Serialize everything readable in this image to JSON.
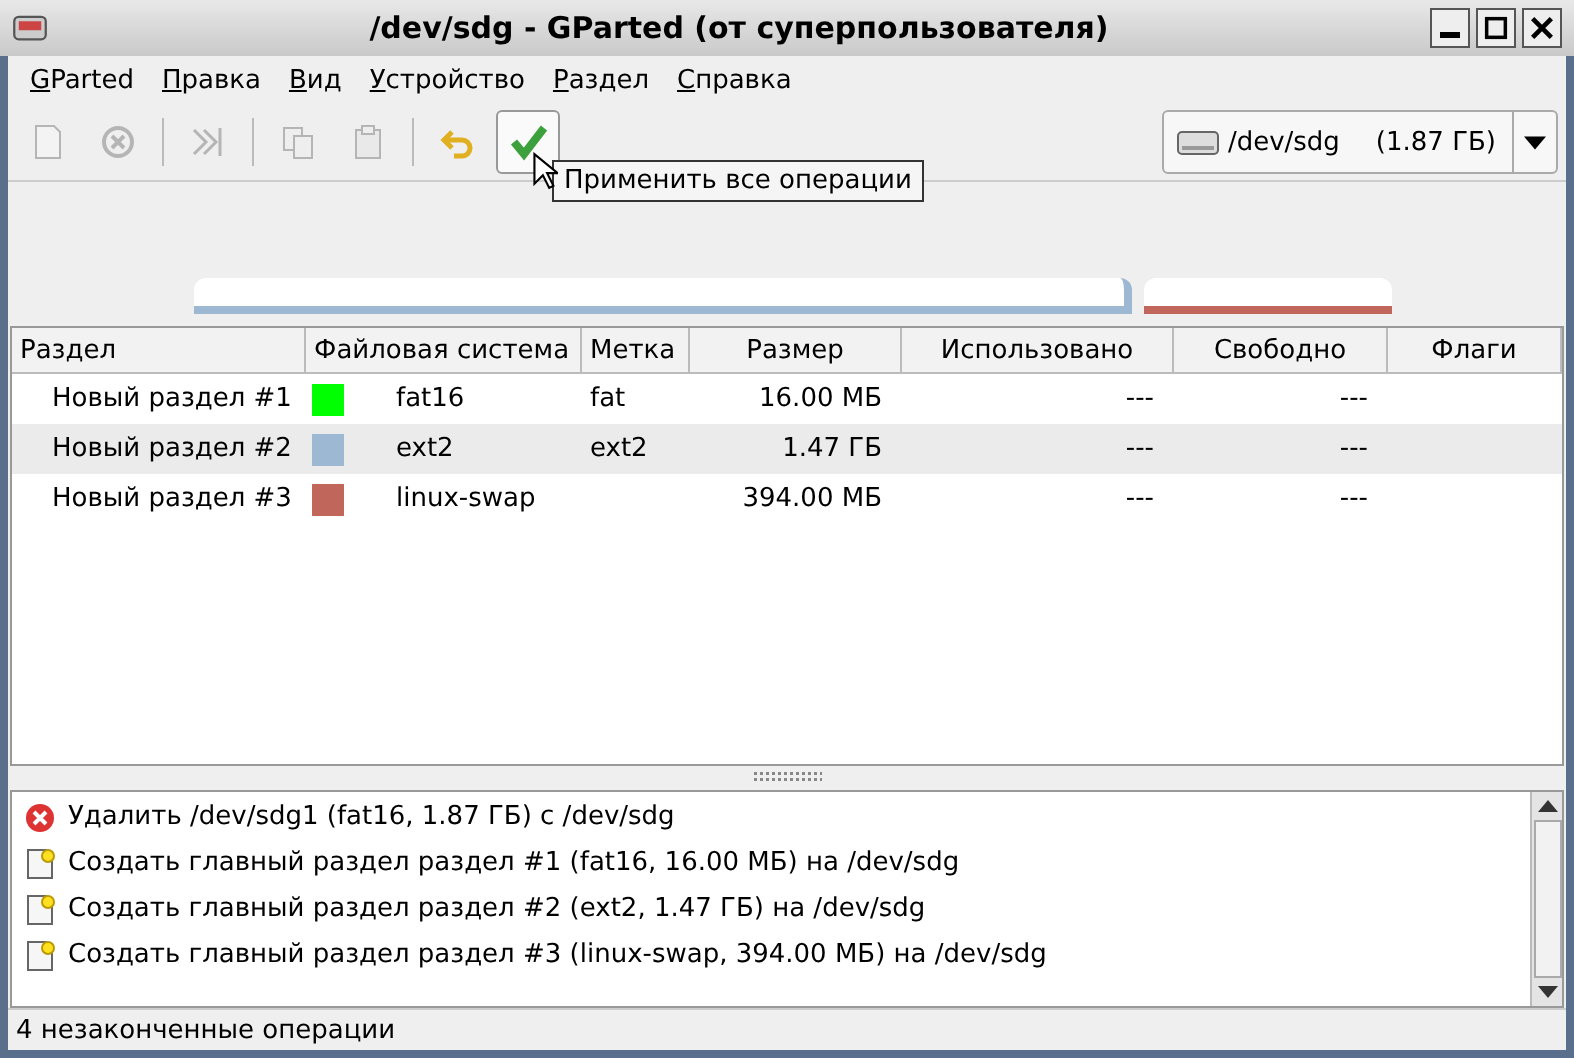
{
  "window": {
    "title": "/dev/sdg - GParted (от суперпользователя)"
  },
  "menu": [
    "GParted",
    "Правка",
    "Вид",
    "Устройство",
    "Раздел",
    "Справка"
  ],
  "toolbar": [
    {
      "kind": "new",
      "disabled": true
    },
    {
      "kind": "delete",
      "disabled": true
    },
    {
      "kind": "sep"
    },
    {
      "kind": "resize",
      "disabled": true
    },
    {
      "kind": "sep"
    },
    {
      "kind": "copy",
      "disabled": true
    },
    {
      "kind": "paste",
      "disabled": true
    },
    {
      "kind": "sep"
    },
    {
      "kind": "undo",
      "disabled": false
    },
    {
      "kind": "apply",
      "disabled": false
    }
  ],
  "tooltip": "Применить все операции",
  "device": {
    "name": "/dev/sdg",
    "size": "(1.87 ГБ)"
  },
  "disk_map": [
    {
      "color": "#9db8d2"
    },
    {
      "color": "#c1665a"
    }
  ],
  "table": {
    "columns": [
      "Раздел",
      "Файловая система",
      "Метка",
      "Размер",
      "Использовано",
      "Свободно",
      "Флаги"
    ],
    "rows": [
      {
        "partition": "Новый раздел #1",
        "color": "#00ff00",
        "filesystem": "fat16",
        "label": "fat",
        "size": "16.00 МБ",
        "used": "---",
        "free": "---",
        "selected": false
      },
      {
        "partition": "Новый раздел #2",
        "color": "#9db8d2",
        "filesystem": "ext2",
        "label": "ext2",
        "size": "1.47 ГБ",
        "used": "---",
        "free": "---",
        "selected": true
      },
      {
        "partition": "Новый раздел #3",
        "color": "#c1665a",
        "filesystem": "linux-swap",
        "label": "",
        "size": "394.00 МБ",
        "used": "---",
        "free": "---",
        "selected": false
      }
    ]
  },
  "operations": [
    {
      "kind": "delete",
      "text": "Удалить /dev/sdg1 (fat16, 1.87 ГБ) с /dev/sdg"
    },
    {
      "kind": "create",
      "text": "Создать главный раздел раздел #1 (fat16, 16.00 МБ) на /dev/sdg"
    },
    {
      "kind": "create",
      "text": "Создать главный раздел раздел #2 (ext2, 1.47 ГБ) на /dev/sdg"
    },
    {
      "kind": "create",
      "text": "Создать главный раздел раздел #3 (linux-swap, 394.00 МБ) на /dev/sdg"
    }
  ],
  "status_bar": "4 незаконченные операции"
}
